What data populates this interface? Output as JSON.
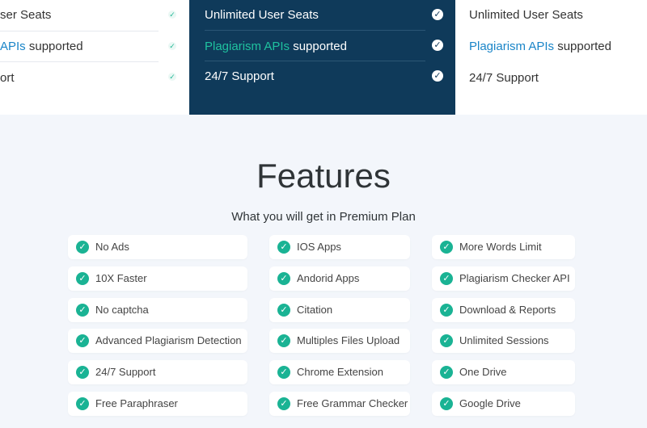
{
  "pricing": {
    "left": {
      "row1": "ser Seats",
      "row2_link": "APIs",
      "row2_rest": " supported",
      "row3": "ort"
    },
    "mid": {
      "row1": "Unlimited User Seats",
      "row2_link": "Plagiarism APIs",
      "row2_rest": " supported",
      "row3": "24/7 Support"
    },
    "right": {
      "row1": "Unlimited User Seats",
      "row2_link": "Plagiarism APIs",
      "row2_rest": " supported",
      "row3": "24/7 Support"
    },
    "check_glyph": "✓"
  },
  "features": {
    "title": "Features",
    "subtitle": "What you will get in Premium Plan",
    "col1": [
      "No Ads",
      "10X Faster",
      "No captcha",
      "Advanced Plagiarism Detection",
      "24/7 Support",
      "Free Paraphraser"
    ],
    "col2": [
      "IOS Apps",
      "Andorid Apps",
      "Citation",
      "Multiples Files Upload",
      "Chrome Extension",
      "Free Grammar Checker"
    ],
    "col3": [
      "More Words Limit",
      "Plagiarism Checker API",
      "Download & Reports",
      "Unlimited Sessions",
      "One Drive",
      "Google Drive"
    ],
    "check_icon": "check-circle-icon"
  },
  "colors": {
    "accent_green": "#1ab394",
    "navy": "#0f3a5a",
    "link_blue": "#1a85c8",
    "background": "#f3f6fb"
  }
}
